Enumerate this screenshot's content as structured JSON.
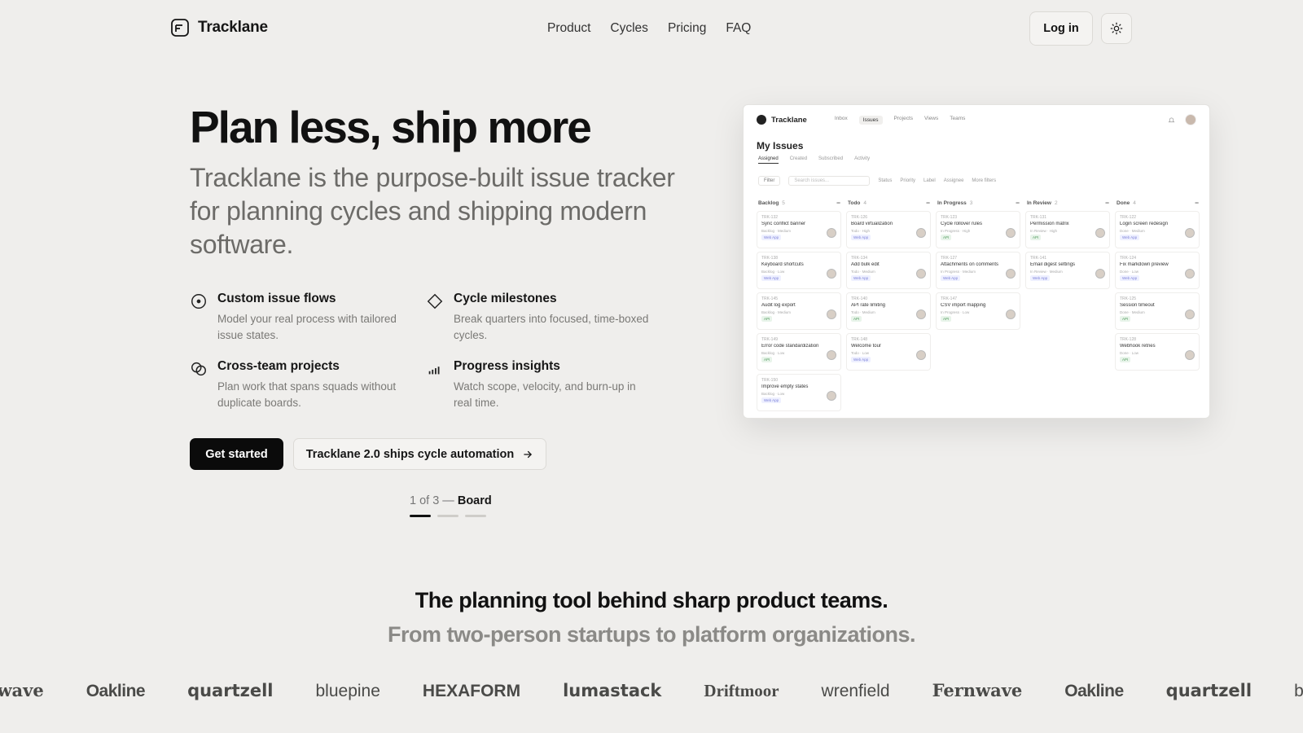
{
  "header": {
    "brand": "Tracklane",
    "nav": [
      "Product",
      "Cycles",
      "Pricing",
      "FAQ"
    ],
    "login": "Log in",
    "theme_icon": "sun-icon"
  },
  "hero": {
    "title": "Plan less, ship more",
    "subtitle": "Tracklane is the purpose-built issue tracker for planning cycles and shipping modern software.",
    "features": [
      {
        "icon": "target-icon",
        "title": "Custom issue flows",
        "desc": "Model your real process with tailored issue states."
      },
      {
        "icon": "diamond-icon",
        "title": "Cycle milestones",
        "desc": "Break quarters into focused, time-boxed cycles."
      },
      {
        "icon": "link-circles-icon",
        "title": "Cross-team projects",
        "desc": "Plan work that spans squads without duplicate boards."
      },
      {
        "icon": "bar-chart-icon",
        "title": "Progress insights",
        "desc": "Watch scope, velocity, and burn-up in real time."
      }
    ],
    "cta_primary": "Get started",
    "cta_secondary": "Tracklane 2.0 ships cycle automation",
    "pager_prefix": "1 of 3 —",
    "pager_label": "Board",
    "pager_total": 3,
    "pager_current": 1
  },
  "mock": {
    "brand": "Tracklane",
    "nav": [
      "Inbox",
      "Issues",
      "Projects",
      "Views",
      "Teams"
    ],
    "active_nav": "Issues",
    "title": "My Issues",
    "tabs": [
      "Assigned",
      "Created",
      "Subscribed",
      "Activity"
    ],
    "filter": "Filter",
    "search_placeholder": "Search issues...",
    "filter_chips": [
      "Status",
      "Priority",
      "Label",
      "Assignee",
      "More filters"
    ],
    "columns": [
      {
        "name": "Backlog",
        "count": "5",
        "cards": [
          {
            "id": "TRK-132",
            "title": "Sync conflict banner",
            "status": "Backlog",
            "priority": "Medium",
            "tag": "Web App"
          },
          {
            "id": "TRK-138",
            "title": "Keyboard shortcuts",
            "status": "Backlog",
            "priority": "Low",
            "tag": "Web App"
          },
          {
            "id": "TRK-145",
            "title": "Audit log export",
            "status": "Backlog",
            "priority": "Medium",
            "tag": "API"
          },
          {
            "id": "TRK-149",
            "title": "Error code standardization",
            "status": "Backlog",
            "priority": "Low",
            "tag": "API"
          },
          {
            "id": "TRK-150",
            "title": "Improve empty states",
            "status": "Backlog",
            "priority": "Low",
            "tag": "Web App"
          }
        ]
      },
      {
        "name": "Todo",
        "count": "4",
        "cards": [
          {
            "id": "TRK-126",
            "title": "Board virtualization",
            "status": "Todo",
            "priority": "High",
            "tag": "Web App"
          },
          {
            "id": "TRK-134",
            "title": "Add bulk edit",
            "status": "Todo",
            "priority": "Medium",
            "tag": "Web App"
          },
          {
            "id": "TRK-140",
            "title": "API rate limiting",
            "status": "Todo",
            "priority": "Medium",
            "tag": "API"
          },
          {
            "id": "TRK-148",
            "title": "Welcome tour",
            "status": "Todo",
            "priority": "Low",
            "tag": "Web App"
          }
        ]
      },
      {
        "name": "In Progress",
        "count": "3",
        "cards": [
          {
            "id": "TRK-123",
            "title": "Cycle rollover rules",
            "status": "In Progress",
            "priority": "High",
            "tag": "API"
          },
          {
            "id": "TRK-127",
            "title": "Attachments on comments",
            "status": "In Progress",
            "priority": "Medium",
            "tag": "Web App"
          },
          {
            "id": "TRK-147",
            "title": "CSV import mapping",
            "status": "In Progress",
            "priority": "Low",
            "tag": "API"
          }
        ]
      },
      {
        "name": "In Review",
        "count": "2",
        "cards": [
          {
            "id": "TRK-131",
            "title": "Permission matrix",
            "status": "In Review",
            "priority": "High",
            "tag": "API"
          },
          {
            "id": "TRK-141",
            "title": "Email digest settings",
            "status": "In Review",
            "priority": "Medium",
            "tag": "Web App"
          }
        ]
      },
      {
        "name": "Done",
        "count": "4",
        "cards": [
          {
            "id": "TRK-122",
            "title": "Login screen redesign",
            "status": "Done",
            "priority": "Medium",
            "tag": "Web App"
          },
          {
            "id": "TRK-124",
            "title": "Fix markdown preview",
            "status": "Done",
            "priority": "Low",
            "tag": "Web App"
          },
          {
            "id": "TRK-125",
            "title": "Session timeout",
            "status": "Done",
            "priority": "Medium",
            "tag": "API"
          },
          {
            "id": "TRK-128",
            "title": "Webhook retries",
            "status": "Done",
            "priority": "Low",
            "tag": "API"
          }
        ]
      }
    ]
  },
  "proof": {
    "title": "The planning tool behind sharp product teams.",
    "subtitle": "From two-person startups to platform organizations.",
    "logos": [
      "Fernwave",
      "Oakline",
      "quartzell",
      "bluepine",
      "HEXAFORM",
      "lumastack",
      "Driftmoor",
      "wrenfield",
      "Fernwave",
      "Oakline",
      "quartzell",
      "bluepine"
    ]
  },
  "colors": {
    "background": "#efeeec",
    "primary_button": "#0b0b0b",
    "muted_text": "#6c6b68"
  }
}
